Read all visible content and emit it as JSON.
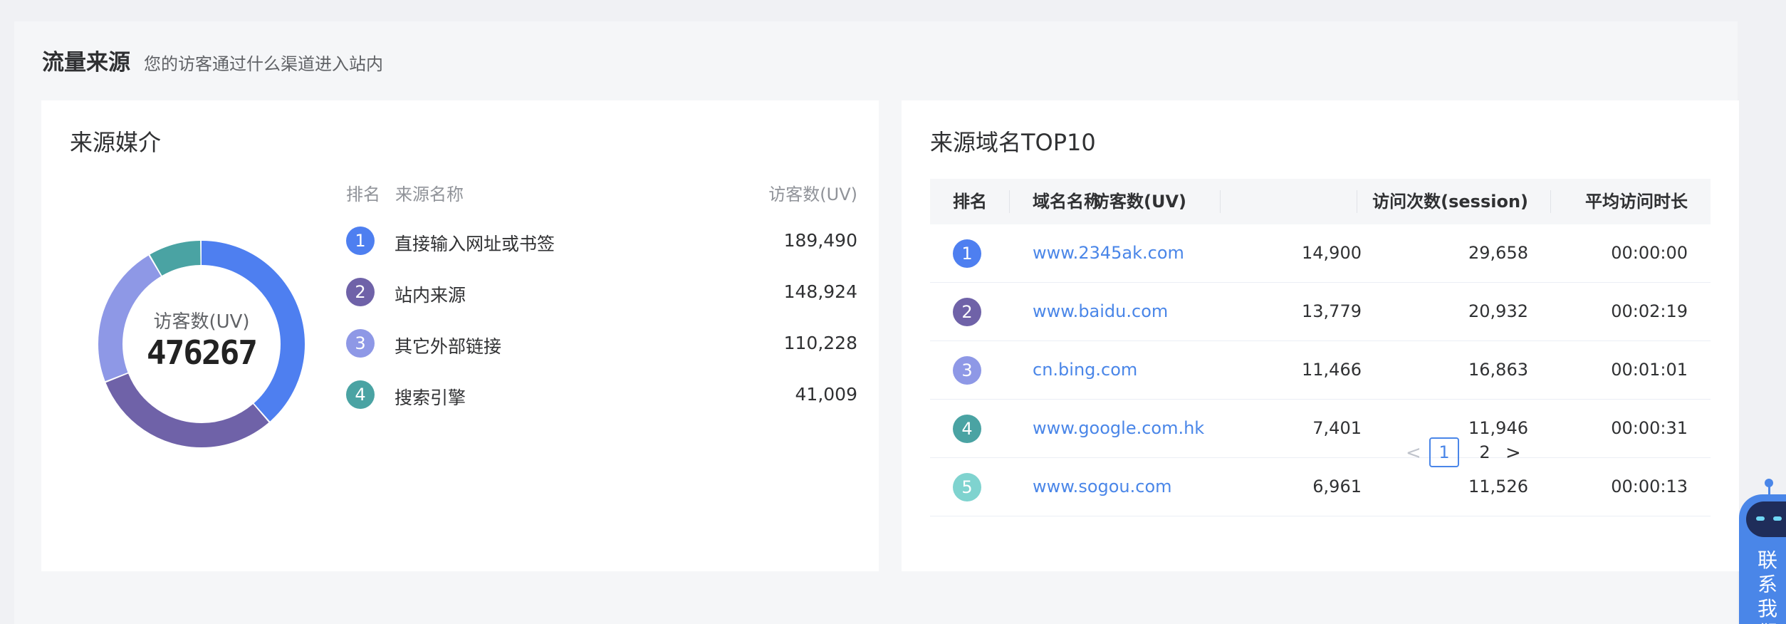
{
  "header": {
    "title": "流量来源",
    "subtitle": "您的访客通过什么渠道进入站内"
  },
  "media": {
    "title": "来源媒介",
    "headers": {
      "rank": "排名",
      "name": "来源名称",
      "uv": "访客数(UV)"
    },
    "total_label": "访客数(UV)",
    "total": "476267",
    "items": [
      {
        "rank": "1",
        "name": "直接输入网址或书签",
        "uv": "189,490",
        "value": 189490,
        "color": "#4e7ff0"
      },
      {
        "rank": "2",
        "name": "站内来源",
        "uv": "148,924",
        "value": 148924,
        "color": "#6f62a8"
      },
      {
        "rank": "3",
        "name": "其它外部链接",
        "uv": "110,228",
        "value": 110228,
        "color": "#8e98e6"
      },
      {
        "rank": "4",
        "name": "搜索引擎",
        "uv": "41,009",
        "value": 41009,
        "color": "#4aa3a3"
      }
    ]
  },
  "domains": {
    "title": "来源域名TOP10",
    "headers": {
      "rank": "排名",
      "name": "域名名称",
      "uv": "访客数(UV)",
      "session": "访问次数(session)",
      "avg": "平均访问时长"
    },
    "rows": [
      {
        "rank": "1",
        "domain": "www.2345ak.com",
        "uv": "14,900",
        "session": "29,658",
        "avg": "00:00:00",
        "color": "#4e7ff0"
      },
      {
        "rank": "2",
        "domain": "www.baidu.com",
        "uv": "13,779",
        "session": "20,932",
        "avg": "00:02:19",
        "color": "#6f62a8"
      },
      {
        "rank": "3",
        "domain": "cn.bing.com",
        "uv": "11,466",
        "session": "16,863",
        "avg": "00:01:01",
        "color": "#8e98e6"
      },
      {
        "rank": "4",
        "domain": "www.google.com.hk",
        "uv": "7,401",
        "session": "11,946",
        "avg": "00:00:31",
        "color": "#4aa3a3"
      },
      {
        "rank": "5",
        "domain": "www.sogou.com",
        "uv": "6,961",
        "session": "11,526",
        "avg": "00:00:13",
        "color": "#7fd3cf"
      }
    ]
  },
  "pagination": {
    "prev": "<",
    "page1": "1",
    "page2": "2",
    "next": ">"
  },
  "contact": {
    "label": "联系我们"
  },
  "icons": {
    "prev": "chevron-left-icon",
    "next": "chevron-right-icon",
    "robot": "robot-icon"
  }
}
